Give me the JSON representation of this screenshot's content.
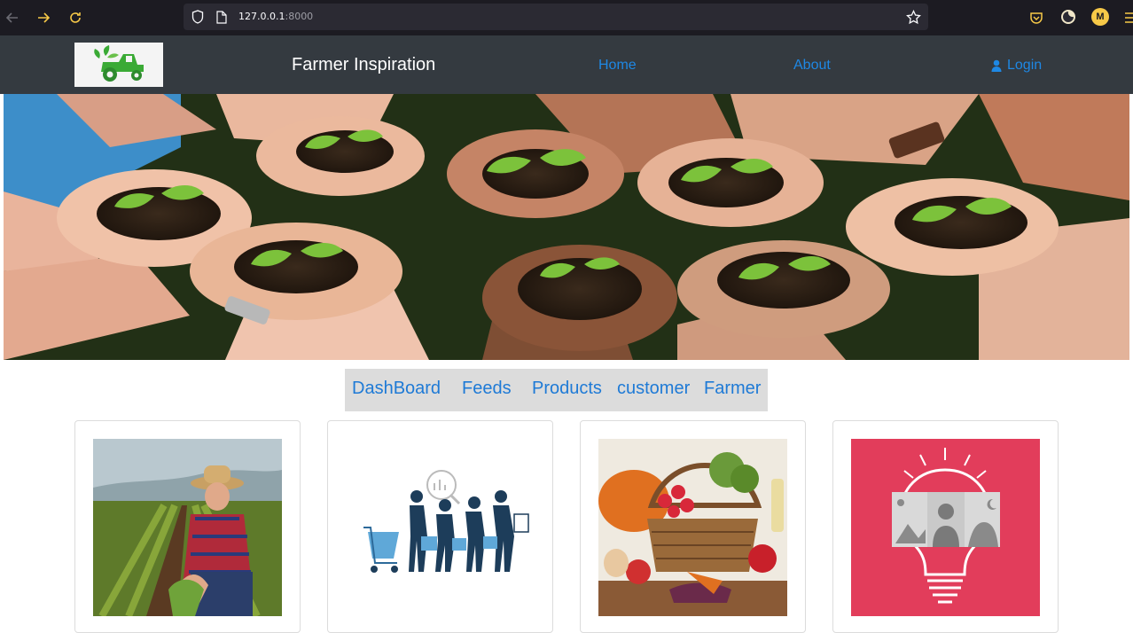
{
  "browser": {
    "url_host": "127.0.0.1",
    "url_port": ":8000",
    "profile_initial": "M"
  },
  "navbar": {
    "brand": "Farmer Inspiration",
    "home": "Home",
    "about": "About",
    "login": "Login"
  },
  "menu": {
    "dashboard": "DashBoard",
    "feeds": "Feeds",
    "products": "Products",
    "customer": "customer",
    "farmer": "Farmer"
  },
  "colors": {
    "navbar_bg": "#343a40",
    "link": "#1e88e5",
    "menu_bg": "#dcdcdc",
    "card4_bg": "#e23d5b"
  }
}
